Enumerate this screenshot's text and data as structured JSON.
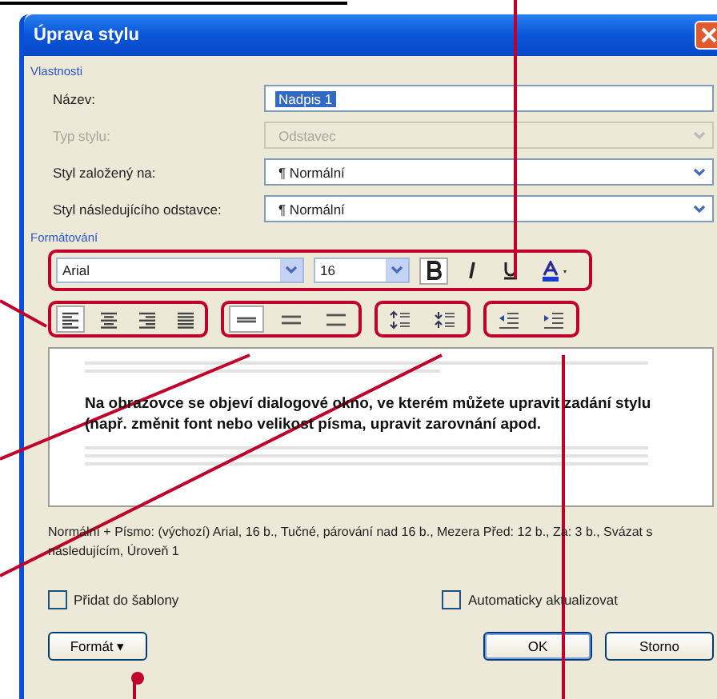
{
  "window": {
    "title": "Úprava stylu"
  },
  "properties": {
    "heading": "Vlastnosti",
    "fields": [
      {
        "label": "Název:",
        "value": "Nadpis 1",
        "kind": "text",
        "disabled": false
      },
      {
        "label": "Typ stylu:",
        "value": "Odstavec",
        "kind": "select",
        "disabled": true
      },
      {
        "label": "Styl založený na:",
        "value": "¶ Normální",
        "kind": "select",
        "disabled": false
      },
      {
        "label": "Styl následujícího odstavce:",
        "value": "¶ Normální",
        "kind": "select",
        "disabled": false
      }
    ]
  },
  "formatting": {
    "heading": "Formátování",
    "font": "Arial",
    "size": "16",
    "styles": [
      {
        "kind": "bold",
        "selected": true
      },
      {
        "kind": "italic",
        "selected": false
      },
      {
        "kind": "underline",
        "selected": false
      }
    ],
    "alignment": [
      {
        "kind": "left",
        "selected": true
      },
      {
        "kind": "center",
        "selected": false
      },
      {
        "kind": "right",
        "selected": false
      },
      {
        "kind": "justify",
        "selected": false
      }
    ],
    "line_spacing": [
      {
        "kind": "single",
        "selected": true
      },
      {
        "kind": "one-half",
        "selected": false
      },
      {
        "kind": "double",
        "selected": false
      }
    ],
    "paragraph_spacing": [
      {
        "kind": "increase",
        "selected": false
      },
      {
        "kind": "decrease",
        "selected": false
      }
    ],
    "indent": [
      {
        "kind": "decrease",
        "selected": false
      },
      {
        "kind": "increase",
        "selected": false
      }
    ]
  },
  "preview": {
    "text": "Na obrazovce se objeví dialogové okno, ve kterém můžete upravit zadání stylu (např. změnit font nebo velikost písma, upravit zarovnání apod."
  },
  "description": "Normální + Písmo: (výchozí) Arial, 16 b., Tučné, párování nad 16 b., Mezera Před: 12 b., Za: 3 b., Svázat s následujícím, Úroveň 1",
  "checkboxes": [
    {
      "label": "Přidat do šablony",
      "checked": false
    },
    {
      "label": "Automaticky aktualizovat",
      "checked": false
    }
  ],
  "buttons": {
    "format": "Formát ▾",
    "ok": "OK",
    "cancel": "Storno"
  }
}
